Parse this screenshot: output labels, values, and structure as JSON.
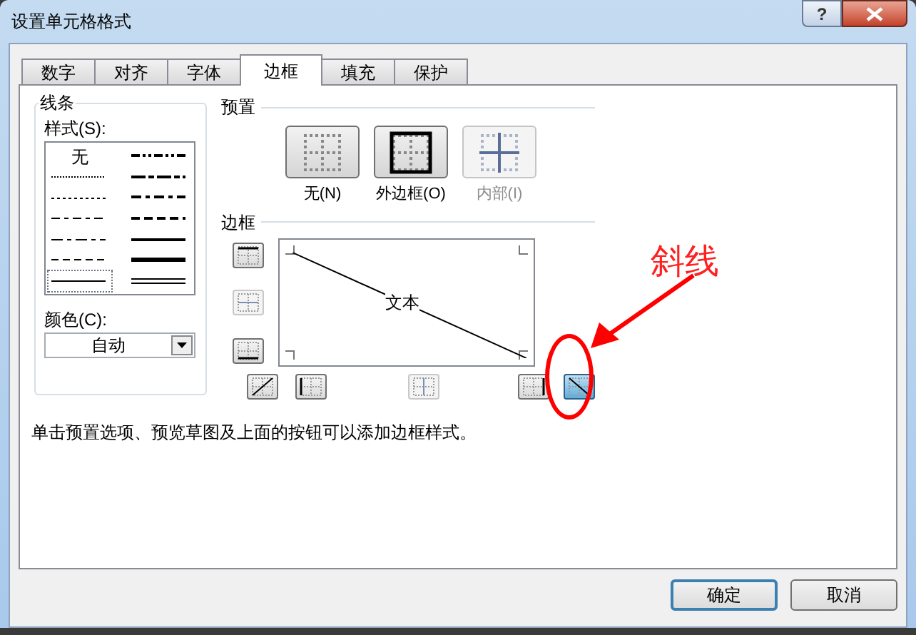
{
  "window": {
    "title": "设置单元格格式",
    "help_glyph": "?"
  },
  "tabs": [
    {
      "label": "数字",
      "selected": false
    },
    {
      "label": "对齐",
      "selected": false
    },
    {
      "label": "字体",
      "selected": false
    },
    {
      "label": "边框",
      "selected": true
    },
    {
      "label": "填充",
      "selected": false
    },
    {
      "label": "保护",
      "selected": false
    }
  ],
  "line": {
    "title": "线条",
    "style_label": "样式(S):",
    "styles": [
      {
        "kind": "none",
        "label": "无",
        "selected": false
      },
      {
        "kind": "dash-dot-dot",
        "selected": false
      },
      {
        "kind": "hair",
        "selected": false
      },
      {
        "kind": "slant-dash-dot",
        "selected": false
      },
      {
        "kind": "dotted",
        "selected": false
      },
      {
        "kind": "medium-dash-dot",
        "selected": false
      },
      {
        "kind": "dash-dot-dot-thin",
        "selected": false
      },
      {
        "kind": "medium-dashed",
        "selected": false
      },
      {
        "kind": "dash-dot",
        "selected": false
      },
      {
        "kind": "medium",
        "selected": false
      },
      {
        "kind": "dashed",
        "selected": false
      },
      {
        "kind": "thick",
        "selected": false
      },
      {
        "kind": "thin",
        "selected": true
      },
      {
        "kind": "double",
        "selected": false
      }
    ],
    "color_label": "颜色(C):",
    "color_value": "自动"
  },
  "presets": {
    "title": "预置",
    "items": [
      {
        "kind": "none",
        "label": "无(N)",
        "disabled": false
      },
      {
        "kind": "outline",
        "label": "外边框(O)",
        "disabled": false
      },
      {
        "kind": "inside",
        "label": "内部(I)",
        "disabled": true
      }
    ]
  },
  "border": {
    "title": "边框",
    "preview_text": "文本",
    "side_buttons": [
      {
        "kind": "top",
        "selected": false,
        "disabled": false
      },
      {
        "kind": "middle-h",
        "selected": false,
        "disabled": true
      },
      {
        "kind": "bottom",
        "selected": false,
        "disabled": false
      }
    ],
    "bottom_buttons": [
      {
        "kind": "diag-up",
        "selected": false,
        "disabled": false
      },
      {
        "kind": "left",
        "selected": false,
        "disabled": false
      },
      {
        "kind": "middle-v",
        "selected": false,
        "disabled": true
      },
      {
        "kind": "right",
        "selected": false,
        "disabled": false
      },
      {
        "kind": "diag-down",
        "selected": true,
        "disabled": false
      }
    ]
  },
  "hint": "单击预置选项、预览草图及上面的按钮可以添加边框样式。",
  "annotation": {
    "text": "斜线"
  },
  "buttons": [
    {
      "label": "确定",
      "default": true
    },
    {
      "label": "取消",
      "default": false
    }
  ]
}
